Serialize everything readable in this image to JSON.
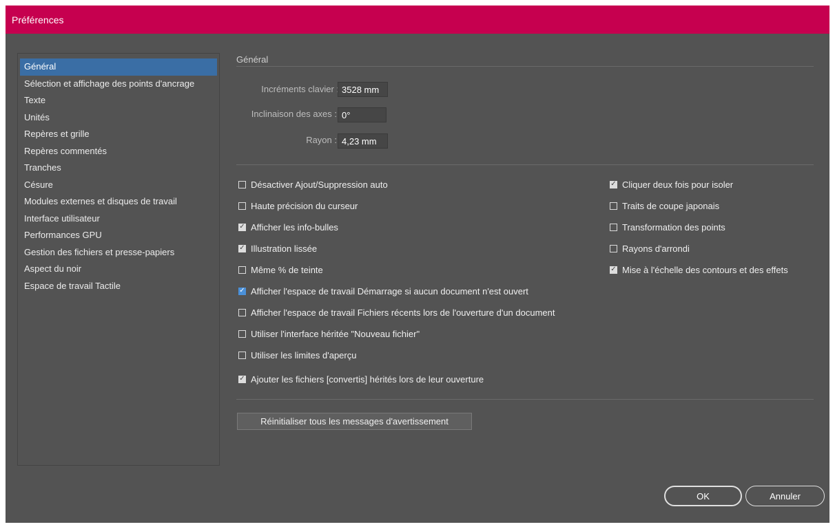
{
  "window": {
    "title": "Préférences"
  },
  "sidebar": {
    "items": [
      {
        "label": "Général",
        "selected": true
      },
      {
        "label": "Sélection et affichage des points d'ancrage"
      },
      {
        "label": "Texte"
      },
      {
        "label": "Unités"
      },
      {
        "label": "Repères et grille"
      },
      {
        "label": "Repères commentés"
      },
      {
        "label": "Tranches"
      },
      {
        "label": "Césure"
      },
      {
        "label": "Modules externes et disques de travail"
      },
      {
        "label": "Interface utilisateur"
      },
      {
        "label": "Performances GPU"
      },
      {
        "label": "Gestion des fichiers et presse-papiers"
      },
      {
        "label": "Aspect du noir"
      },
      {
        "label": "Espace de travail Tactile"
      }
    ]
  },
  "main": {
    "section_title": "Général",
    "fields": {
      "keyboard_increment": {
        "label": "Incréments clavier :",
        "value": "3528 mm"
      },
      "constrain_angle": {
        "label": "Inclinaison des axes :",
        "value": "0°"
      },
      "corner_radius": {
        "label": "Rayon :",
        "value": "4,23 mm"
      }
    },
    "checkboxes_left": [
      {
        "label": "Désactiver Ajout/Suppression auto",
        "checked": false
      },
      {
        "label": "Haute précision du curseur",
        "checked": false
      },
      {
        "label": "Afficher les info-bulles",
        "checked": true
      },
      {
        "label": "Illustration lissée",
        "checked": true
      },
      {
        "label": "Même % de teinte",
        "checked": false
      },
      {
        "label": "Afficher l'espace de travail Démarrage si aucun document n'est ouvert",
        "checked": true
      },
      {
        "label": "Afficher l'espace de travail Fichiers récents lors de l'ouverture d'un document",
        "checked": false
      },
      {
        "label": "Utiliser l'interface héritée \"Nouveau fichier\"",
        "checked": false
      },
      {
        "label": "Utiliser les limites d'aperçu",
        "checked": false
      },
      {
        "label": "Ajouter les fichiers [convertis] hérités lors de leur ouverture",
        "checked": true
      }
    ],
    "checkboxes_right": [
      {
        "label": "Cliquer deux fois pour isoler",
        "checked": true
      },
      {
        "label": "Traits de coupe japonais",
        "checked": false
      },
      {
        "label": "Transformation des points",
        "checked": false
      },
      {
        "label": "Rayons d'arrondi",
        "checked": false
      },
      {
        "label": "Mise à l'échelle des contours et des effets",
        "checked": true
      }
    ],
    "reset_label": "Réinitialiser tous les messages d'avertissement"
  },
  "footer": {
    "ok_label": "OK",
    "cancel_label": "Annuler"
  },
  "colors": {
    "titlebar": "#c6004f",
    "panel": "#535353",
    "selection": "#3a6ea5"
  }
}
